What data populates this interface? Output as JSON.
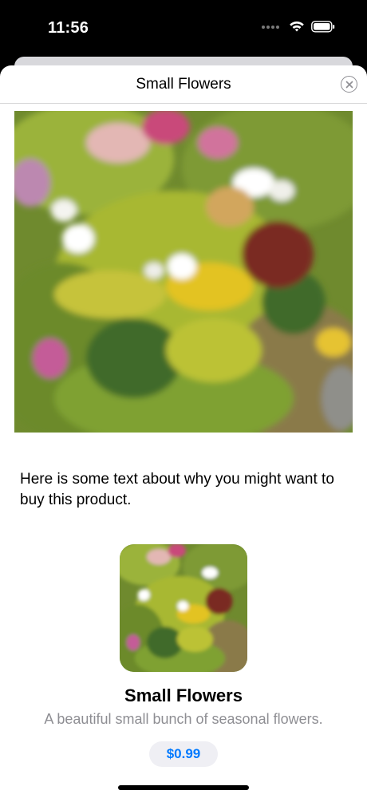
{
  "status_bar": {
    "time": "11:56"
  },
  "sheet": {
    "title": "Small Flowers",
    "close_icon": "xmark-circle-icon"
  },
  "product": {
    "description": "Here is some text about why you might want to buy this product.",
    "name": "Small Flowers",
    "subtitle": "A beautiful small bunch of seasonal flowers.",
    "price": "$0.99"
  },
  "colors": {
    "accent": "#007aff",
    "secondary_text": "#8e8e93",
    "price_pill": "#efeff4"
  }
}
